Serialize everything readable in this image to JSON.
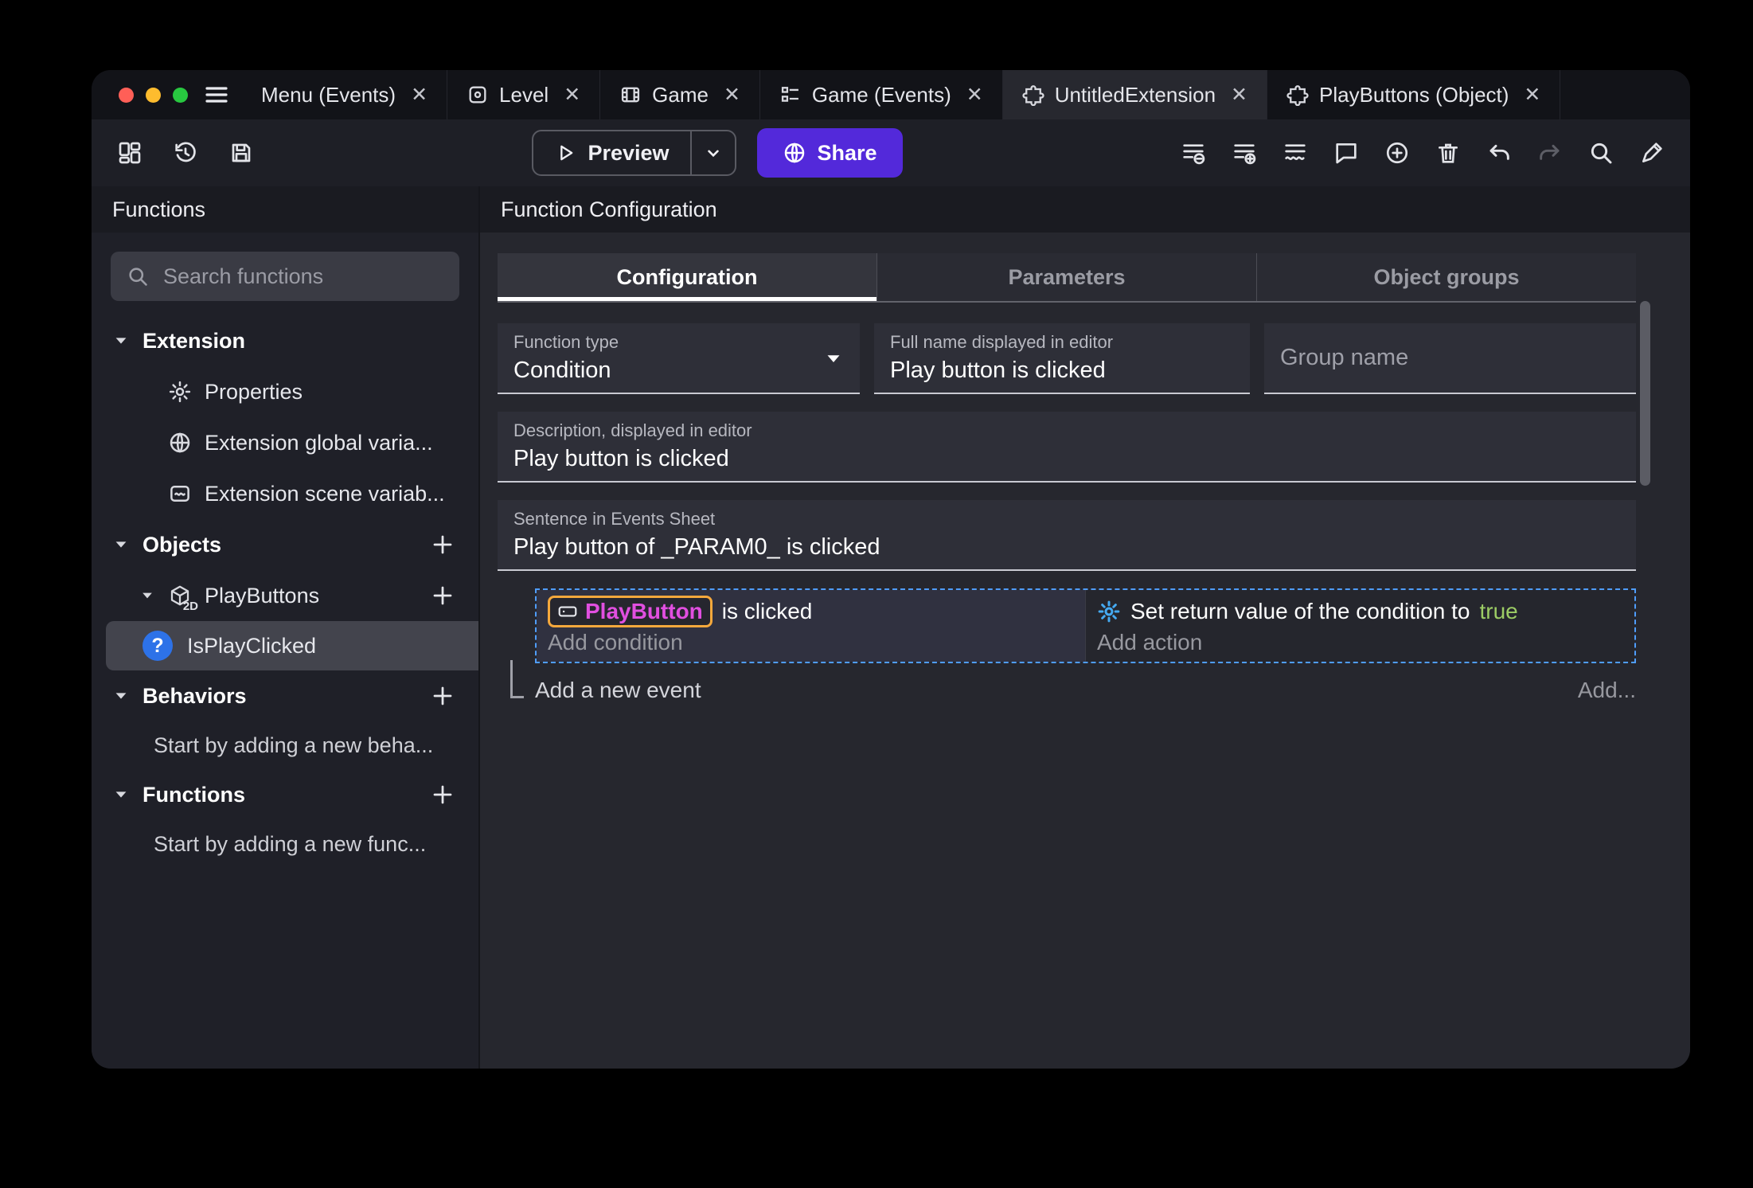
{
  "colors": {
    "accent_purple": "#5329da",
    "selection_blue": "#4f9dfc",
    "object_highlight_border": "#f5a83c",
    "object_text": "#e14fe0",
    "true_green": "#9ccc65",
    "gear_blue": "#45aaf2"
  },
  "titlebar": {
    "close_glyph": "✕",
    "tabs": [
      {
        "label": "Menu (Events)"
      },
      {
        "label": "Level"
      },
      {
        "label": "Game"
      },
      {
        "label": "Game (Events)"
      },
      {
        "label": "UntitledExtension"
      },
      {
        "label": "PlayButtons (Object)"
      }
    ]
  },
  "toolbar": {
    "preview_label": "Preview",
    "share_label": "Share"
  },
  "sidebar": {
    "header": "Functions",
    "search_placeholder": "Search functions",
    "sections": {
      "extension": {
        "label": "Extension",
        "items": [
          {
            "label": "Properties"
          },
          {
            "label": "Extension global varia..."
          },
          {
            "label": "Extension scene variab..."
          }
        ]
      },
      "objects": {
        "label": "Objects",
        "object": {
          "label": "PlayButtons",
          "icon_sub": "2D"
        },
        "function": {
          "label": "IsPlayClicked",
          "icon_glyph": "?"
        }
      },
      "behaviors": {
        "label": "Behaviors",
        "hint": "Start by adding a new beha..."
      },
      "functions": {
        "label": "Functions",
        "hint": "Start by adding a new func..."
      }
    }
  },
  "main": {
    "header": "Function Configuration",
    "tabs": [
      {
        "label": "Configuration"
      },
      {
        "label": "Parameters"
      },
      {
        "label": "Object groups"
      }
    ],
    "fields": {
      "function_type": {
        "label": "Function type",
        "value": "Condition"
      },
      "full_name": {
        "label": "Full name displayed in editor",
        "value": "Play button is clicked"
      },
      "group_name": {
        "placeholder": "Group name"
      },
      "description": {
        "label": "Description, displayed in editor",
        "value": "Play button is clicked"
      },
      "sentence": {
        "label": "Sentence in Events Sheet",
        "value": "Play button of _PARAM0_ is clicked"
      }
    },
    "events": {
      "condition": {
        "object": "PlayButton",
        "text": "is clicked",
        "add": "Add condition"
      },
      "action": {
        "prefix": "Set return value of the condition to",
        "value": "true",
        "add": "Add action"
      },
      "footer": {
        "add_event": "Add a new event",
        "add_more": "Add..."
      }
    }
  }
}
